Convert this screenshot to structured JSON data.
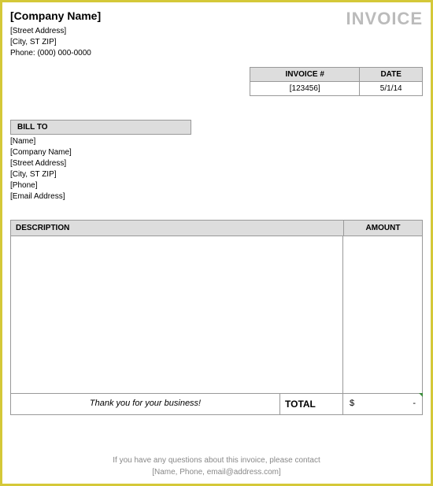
{
  "header": {
    "company_name": "[Company Name]",
    "street": "[Street Address]",
    "city_st_zip": "[City, ST  ZIP]",
    "phone": "Phone: (000) 000-0000",
    "title": "INVOICE"
  },
  "meta": {
    "invoice_num_label": "INVOICE #",
    "date_label": "DATE",
    "invoice_num": "[123456]",
    "date": "5/1/14"
  },
  "billto": {
    "header": "BILL TO",
    "name": "[Name]",
    "company": "[Company Name]",
    "street": "[Street Address]",
    "city_st_zip": "[City, ST  ZIP]",
    "phone": "[Phone]",
    "email": "[Email Address]"
  },
  "items": {
    "description_header": "DESCRIPTION",
    "amount_header": "AMOUNT"
  },
  "totals": {
    "thankyou": "Thank you for your business!",
    "total_label": "TOTAL",
    "currency": "$",
    "total_value": "-"
  },
  "footer": {
    "line1": "If you have any questions about this invoice, please contact",
    "line2": "[Name, Phone, email@address.com]"
  }
}
